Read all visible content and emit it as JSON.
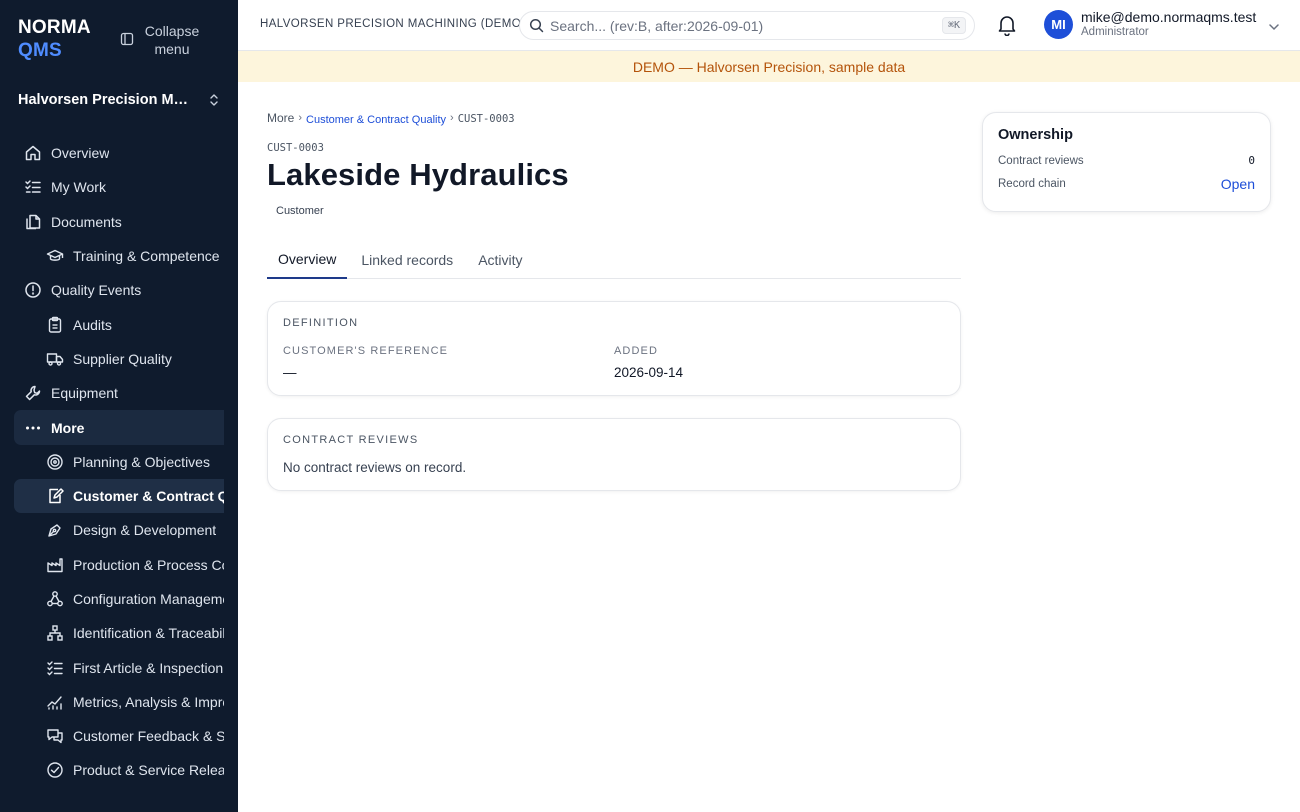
{
  "sidebar": {
    "brand_line1": "NORMA",
    "brand_line2": "QMS",
    "collapse_label": "Collapse menu",
    "org_name": "Halvorsen Precision Machi...",
    "items": [
      {
        "label": "Overview",
        "icon": "home-icon"
      },
      {
        "label": "My Work",
        "icon": "checklist-icon"
      },
      {
        "label": "Documents",
        "icon": "documents-icon"
      },
      {
        "label": "Training & Competence",
        "icon": "graduation-cap-icon"
      },
      {
        "label": "Quality Events",
        "icon": "alert-circle-icon"
      },
      {
        "label": "Audits",
        "icon": "clipboard-icon"
      },
      {
        "label": "Supplier Quality",
        "icon": "truck-icon"
      },
      {
        "label": "Equipment",
        "icon": "wrench-icon"
      },
      {
        "label": "More",
        "icon": "ellipsis-icon"
      },
      {
        "label": "Planning & Objectives",
        "icon": "target-icon"
      },
      {
        "label": "Customer & Contract Quality",
        "icon": "file-signature-icon"
      },
      {
        "label": "Design & Development",
        "icon": "pen-tool-icon"
      },
      {
        "label": "Production & Process Control",
        "icon": "factory-icon"
      },
      {
        "label": "Configuration Management",
        "icon": "network-icon"
      },
      {
        "label": "Identification & Traceability",
        "icon": "hierarchy-icon"
      },
      {
        "label": "First Article & Inspection Records",
        "icon": "list-check-icon"
      },
      {
        "label": "Metrics, Analysis & Improvement",
        "icon": "chart-icon"
      },
      {
        "label": "Customer Feedback & Satisfaction",
        "icon": "message-icon"
      },
      {
        "label": "Product & Service Release",
        "icon": "check-circle-icon"
      }
    ]
  },
  "topbar": {
    "org_label": "HALVORSEN PRECISION MACHINING (DEMO)",
    "search_placeholder": "Search... (rev:B, after:2026-09-01)",
    "search_shortcut": "⌘K",
    "user_initials": "MI",
    "user_email": "mike@demo.normaqms.test",
    "user_role": "Administrator"
  },
  "banner": "DEMO — Halvorsen Precision, sample data",
  "breadcrumb": {
    "root": "More",
    "section": "Customer & Contract Quality",
    "current": "CUST-0003"
  },
  "record": {
    "code": "CUST-0003",
    "title": "Lakeside Hydraulics",
    "type": "Customer"
  },
  "tabs": [
    "Overview",
    "Linked records",
    "Activity"
  ],
  "definition": {
    "heading": "DEFINITION",
    "ref_label": "CUSTOMER'S REFERENCE",
    "ref_value": "—",
    "added_label": "ADDED",
    "added_value": "2026-09-14"
  },
  "contract_reviews": {
    "heading": "CONTRACT REVIEWS",
    "empty": "No contract reviews on record."
  },
  "ownership": {
    "title": "Ownership",
    "reviews_label": "Contract reviews",
    "reviews_count": "0",
    "chain_label": "Record chain",
    "chain_action": "Open"
  },
  "colors": {
    "sidebar_bg": "#0f1b2d",
    "accent": "#1e4fd8",
    "brand_blue": "#4f8cff",
    "banner_bg": "#fdf5dc",
    "banner_text": "#b4530a"
  }
}
